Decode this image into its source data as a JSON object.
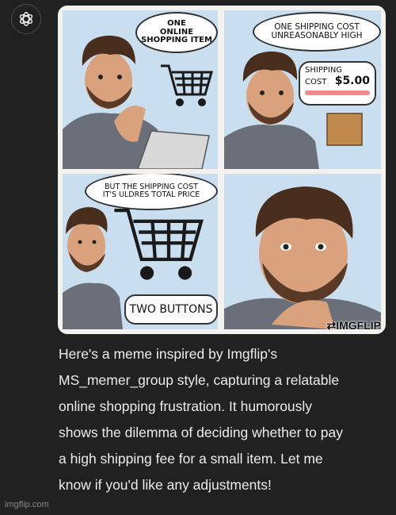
{
  "assistant": {
    "avatar_icon": "openai-logo-icon"
  },
  "meme": {
    "panel1_bubble": [
      "ONE",
      "ONLINE",
      "SHOPPING ITEM"
    ],
    "panel2_bubble": [
      "ONE SHIPPING COST",
      "UNREASONABLY HIGH"
    ],
    "shipping_sign": {
      "line1": "SHIPPING",
      "line2": "COST",
      "price": "$5.00"
    },
    "panel3_bubble": [
      "BUT THE SHIPPING COST",
      "IT'S ULDRES TOTAL PRICE"
    ],
    "panel3_sign": "TWO BUTTONS",
    "watermark": "⇄IMGFLIP"
  },
  "message": {
    "lines": [
      "Here's a meme inspired by Imgflip's",
      "MS_memer_group style, capturing a relatable",
      "online shopping frustration. It humorously",
      "shows the dilemma of deciding whether to pay",
      "a high shipping fee for a small item. Let me",
      "know if you'd like any adjustments!"
    ]
  },
  "footer": {
    "source": "imgflip.com"
  }
}
